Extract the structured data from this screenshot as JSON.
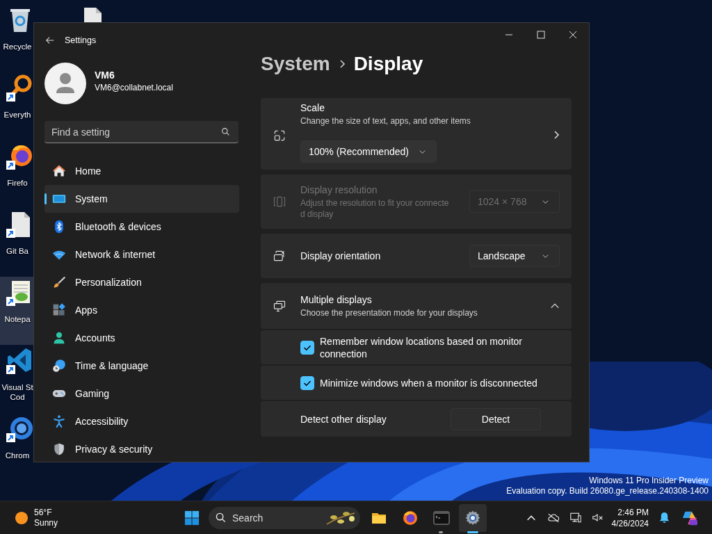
{
  "desktop_icons": [
    [
      {
        "label": "Recycle",
        "selected": false
      },
      {
        "label": "Everyth",
        "selected": false
      },
      {
        "label": "Firefo",
        "selected": false
      },
      {
        "label": "Git Ba",
        "selected": false
      },
      {
        "label": "Notepa",
        "selected": true
      },
      {
        "label": "Visual St Cod",
        "selected": false
      },
      {
        "label": "Chrom",
        "selected": false
      }
    ],
    [
      {
        "selected": false
      }
    ]
  ],
  "window": {
    "title": "Settings"
  },
  "profile": {
    "name": "VM6",
    "email": "VM6@collabnet.local"
  },
  "search": {
    "placeholder": "Find a setting"
  },
  "nav": [
    {
      "label": "Home",
      "selected": false
    },
    {
      "label": "System",
      "selected": true
    },
    {
      "label": "Bluetooth & devices",
      "selected": false
    },
    {
      "label": "Network & internet",
      "selected": false
    },
    {
      "label": "Personalization",
      "selected": false
    },
    {
      "label": "Apps",
      "selected": false
    },
    {
      "label": "Accounts",
      "selected": false
    },
    {
      "label": "Time & language",
      "selected": false
    },
    {
      "label": "Gaming",
      "selected": false
    },
    {
      "label": "Accessibility",
      "selected": false
    },
    {
      "label": "Privacy & security",
      "selected": false
    }
  ],
  "breadcrumb": [
    "System",
    "Display"
  ],
  "cards": [
    {
      "kind": "scale",
      "title": "Scale",
      "subtitle": "Change the size of text, apps, and other items",
      "dropdown": "100% (Recommended)"
    },
    {
      "kind": "resolution",
      "title": "Display resolution",
      "subtitle": "Adjust the resolution to fit your connected display",
      "dropdown": "1024 × 768",
      "disabled": true
    },
    {
      "kind": "orientation",
      "title": "Display orientation",
      "dropdown": "Landscape"
    },
    {
      "kind": "group",
      "title": "Multiple displays",
      "subtitle": "Choose the presentation mode for your displays",
      "expanded": true,
      "rows": [
        {
          "kind": "checkbox",
          "label": "Remember window locations based on monitor connection",
          "checked": true
        },
        {
          "kind": "checkbox",
          "label": "Minimize windows when a monitor is disconnected",
          "checked": true
        },
        {
          "kind": "button",
          "label": "Detect other display",
          "button": "Detect"
        }
      ]
    }
  ],
  "os_notice": [
    "Windows 11 Pro Insider Preview",
    "Evaluation copy. Build 26080.ge_release.240308-1400"
  ],
  "taskbar": {
    "weather": {
      "temperature": "56°F",
      "condition": "Sunny"
    },
    "search": {
      "placeholder": "Search"
    },
    "apps": [
      {
        "running": false,
        "selected": false
      },
      {
        "running": false,
        "selected": false
      },
      {
        "running": true,
        "selected": false
      },
      {
        "running": true,
        "selected": true
      }
    ],
    "clock": {
      "time": "2:46 PM",
      "date": "4/26/2024"
    }
  }
}
